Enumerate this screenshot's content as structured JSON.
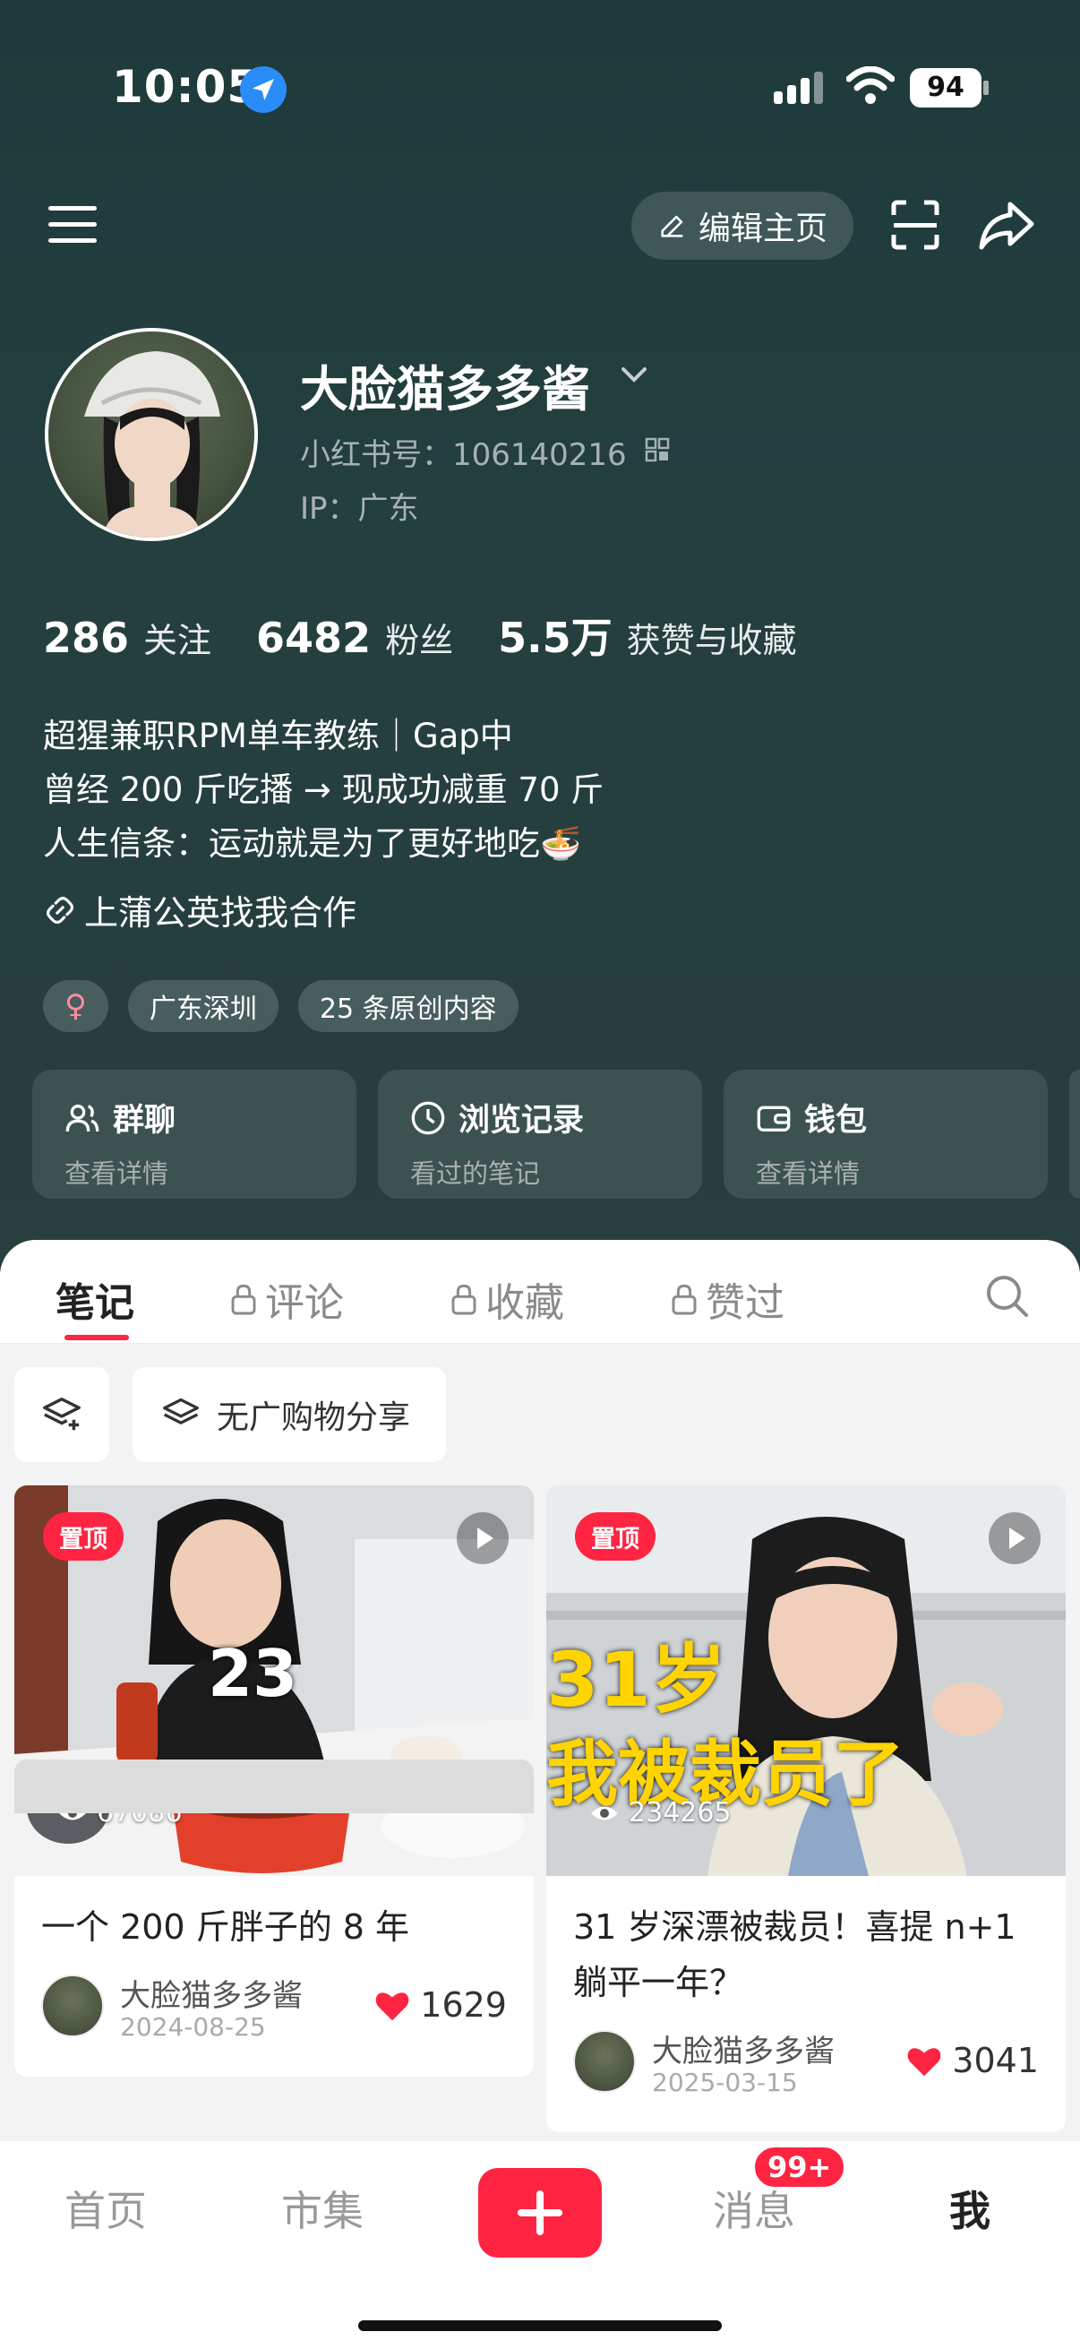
{
  "status_bar": {
    "time": "10:05",
    "battery": "94"
  },
  "header": {
    "edit_label": "编辑主页"
  },
  "profile": {
    "username": "大脸猫多多酱",
    "red_id": "小红书号：106140216",
    "ip": "IP：广东"
  },
  "stats": [
    {
      "num": "286",
      "label": "关注"
    },
    {
      "num": "6482",
      "label": "粉丝"
    },
    {
      "num": "5.5万",
      "label": "获赞与收藏"
    }
  ],
  "bio": {
    "line1": "超猩兼职RPM单车教练｜Gap中",
    "line2": "曾经 200 斤吃播 → 现成功减重 70 斤",
    "line3": "人生信条：运动就是为了更好地吃🍜",
    "coop": "上蒲公英找我合作"
  },
  "tags": {
    "gender": "♀",
    "location": "广东深圳",
    "original": "25 条原创内容"
  },
  "quick_cards": [
    {
      "title": "群聊",
      "sub": "查看详情"
    },
    {
      "title": "浏览记录",
      "sub": "看过的笔记"
    },
    {
      "title": "钱包",
      "sub": "查看详情"
    }
  ],
  "tabs": [
    {
      "label": "笔记"
    },
    {
      "label": "评论"
    },
    {
      "label": "收藏"
    },
    {
      "label": "赞过"
    }
  ],
  "filters": {
    "shop": "无广购物分享"
  },
  "notes": [
    {
      "pin": "置顶",
      "views": "67086",
      "overlay": "23",
      "title": "一个 200 斤胖子的 8 年",
      "author": "大脸猫多多酱",
      "date": "2024-08-25",
      "likes": "1629"
    },
    {
      "pin": "置顶",
      "views": "234265",
      "overlay1": "31岁",
      "overlay2": "我被裁员了",
      "title": "31 岁深漂被裁员！喜提 n+1 躺平一年？",
      "author": "大脸猫多多酱",
      "date": "2025-03-15",
      "likes": "3041"
    }
  ],
  "nav": {
    "home": "首页",
    "market": "市集",
    "messages": "消息",
    "me": "我",
    "badge": "99+"
  },
  "colors": {
    "accent": "#ff2442",
    "header_bg": "#233f3e"
  }
}
